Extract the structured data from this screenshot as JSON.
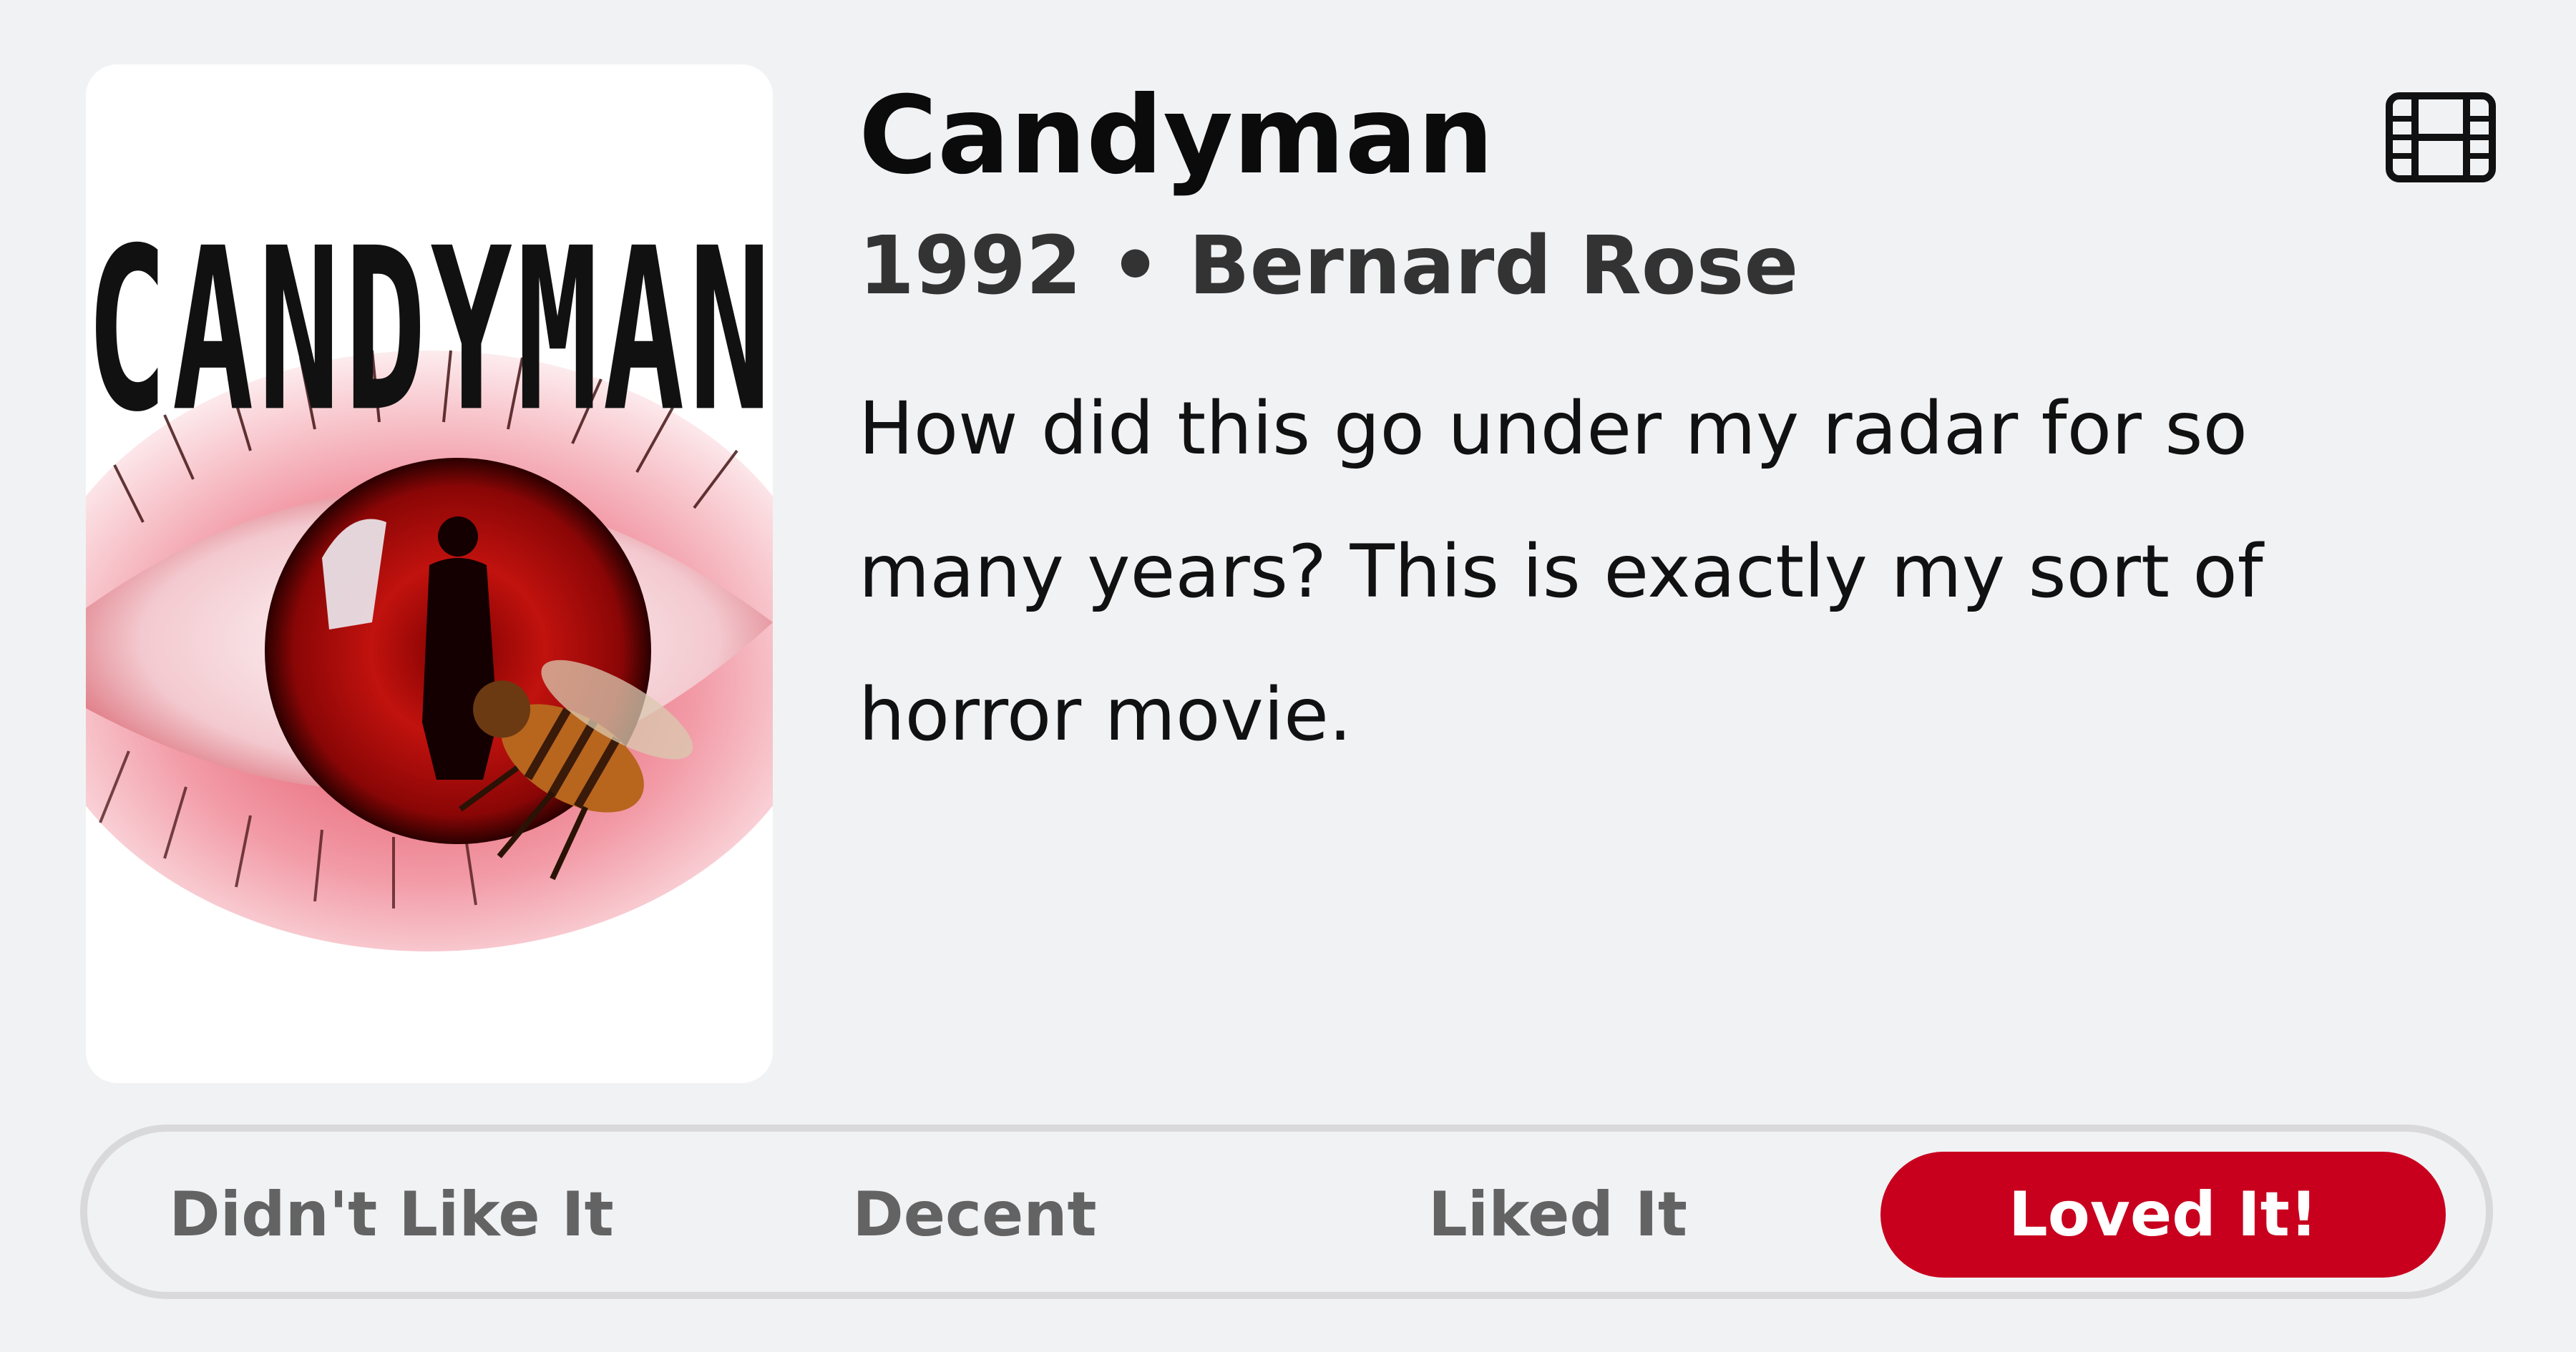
{
  "movie": {
    "title": "Candyman",
    "meta": "1992 • Bernard Rose",
    "review": "How did this go under my radar for so many years? This is exactly my sort of horror movie.",
    "poster_wordmark": "CANDYMAN",
    "type_icon": "film-icon"
  },
  "rating": {
    "options": [
      {
        "label": "Didn't Like It",
        "selected": false
      },
      {
        "label": "Decent",
        "selected": false
      },
      {
        "label": "Liked It",
        "selected": false
      },
      {
        "label": "Loved It!",
        "selected": true
      }
    ],
    "selected_color": "#c8001e"
  },
  "colors": {
    "background": "#f1f2f4",
    "accent": "#c8001e",
    "text_primary": "#0b0b0b",
    "text_secondary": "#333333",
    "option_text": "#636363"
  }
}
